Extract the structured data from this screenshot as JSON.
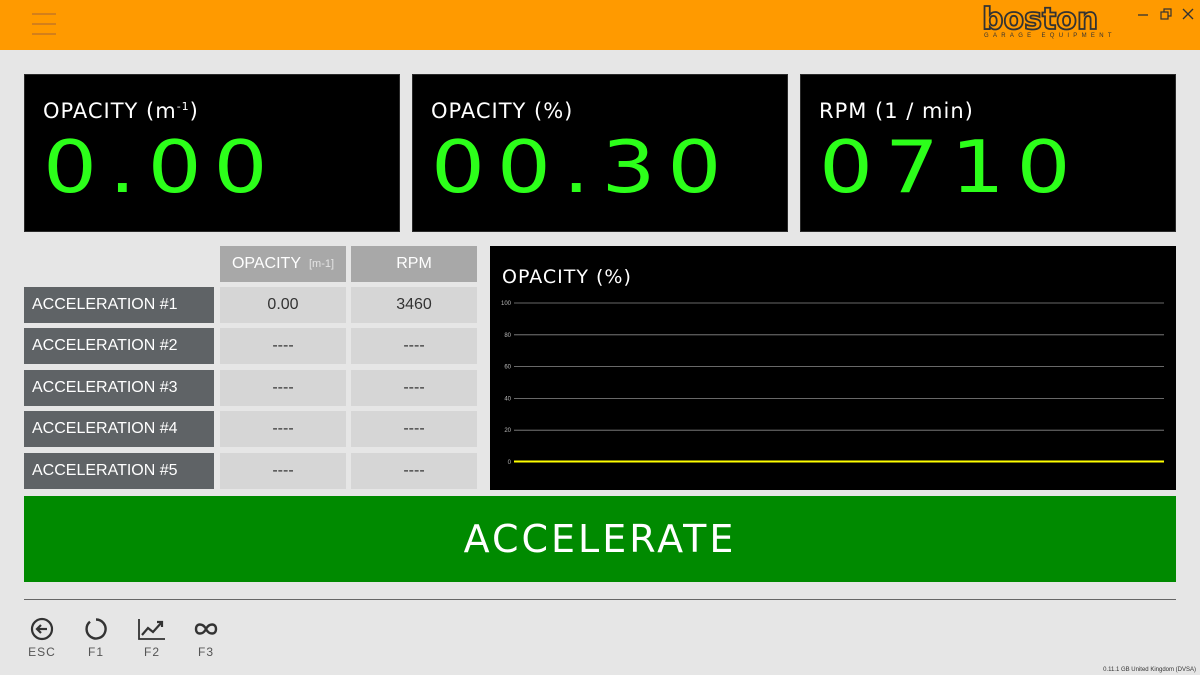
{
  "header": {
    "menu_icon": "hamburger-icon",
    "logo_text": "boston",
    "logo_subtitle": "GARAGE EQUIPMENT",
    "brand_color": "#ff9a00"
  },
  "metrics": [
    {
      "label": "OPACITY (m",
      "label_sup": "-1",
      "label_end": ")",
      "value": "0.00"
    },
    {
      "label": "OPACITY (%)",
      "label_sup": "",
      "label_end": "",
      "value": "00.30"
    },
    {
      "label": "RPM (1 / min)",
      "label_sup": "",
      "label_end": "",
      "value": "0710"
    }
  ],
  "table": {
    "columns": [
      {
        "label": "OPACITY",
        "unit": "[m-1]"
      },
      {
        "label": "RPM",
        "unit": ""
      }
    ],
    "rows": [
      {
        "label": "ACCELERATION #1",
        "opacity": "0.00",
        "rpm": "3460"
      },
      {
        "label": "ACCELERATION #2",
        "opacity": "----",
        "rpm": "----"
      },
      {
        "label": "ACCELERATION #3",
        "opacity": "----",
        "rpm": "----"
      },
      {
        "label": "ACCELERATION #4",
        "opacity": "----",
        "rpm": "----"
      },
      {
        "label": "ACCELERATION #5",
        "opacity": "----",
        "rpm": "----"
      }
    ]
  },
  "chart_data": {
    "type": "line",
    "title": "OPACITY (%)",
    "xlabel": "",
    "ylabel": "",
    "ylim": [
      0,
      100
    ],
    "yticks": [
      "100",
      "80",
      "60",
      "40",
      "20",
      "0"
    ],
    "grid": true,
    "series": [
      {
        "color": "#ffff00",
        "values": [
          0.3,
          0.3,
          0.3,
          0.3,
          0.3,
          0.3,
          0.3,
          0.3,
          0.3,
          0.3
        ]
      }
    ]
  },
  "accelerate_label": "ACCELERATE",
  "footer": {
    "keys": [
      {
        "icon": "back-arrow-icon",
        "label": "ESC"
      },
      {
        "icon": "refresh-circle-icon",
        "label": "F1"
      },
      {
        "icon": "trend-chart-icon",
        "label": "F2"
      },
      {
        "icon": "infinity-icon",
        "label": "F3"
      }
    ],
    "version": "0.11.1 GB United Kingdom (DVSA)"
  },
  "colors": {
    "digits": "#2cff1a",
    "accelerate": "#008a00",
    "row_label_bg": "#5f6366",
    "header_bg": "#a8a8a8",
    "cell_bg": "#d6d6d6"
  }
}
